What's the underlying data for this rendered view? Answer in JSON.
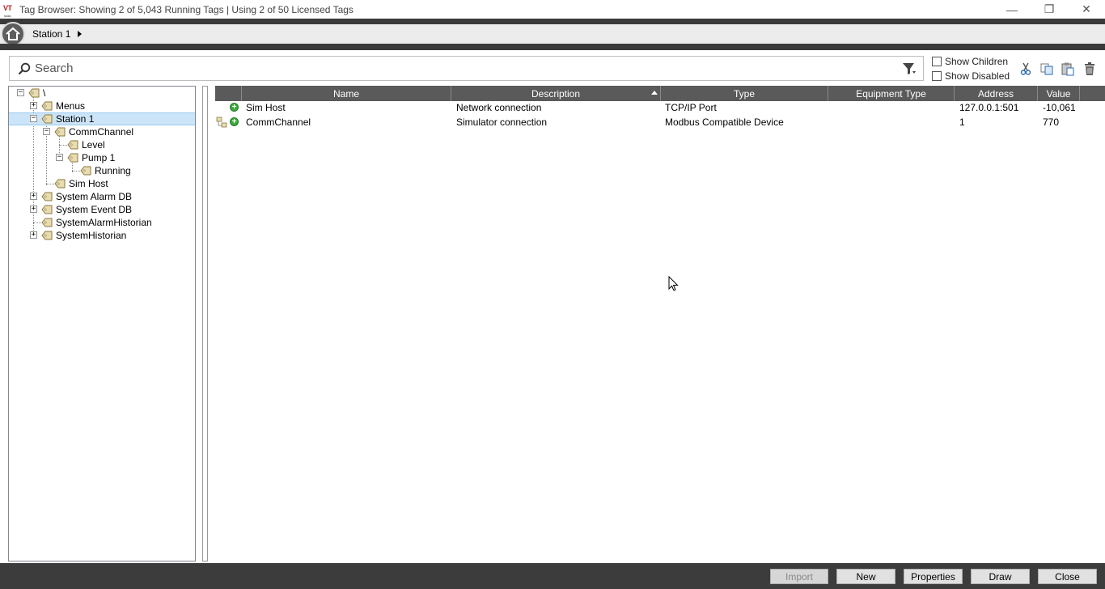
{
  "window": {
    "logo_text": "VT",
    "logo_sub": "SCADA",
    "title": "Tag Browser: Showing 2 of 5,043 Running Tags | Using 2 of 50 Licensed Tags",
    "minimize": "—",
    "restore": "❐",
    "close": "✕"
  },
  "breadcrumb": {
    "current": "Station 1"
  },
  "search": {
    "placeholder": "Search",
    "value": ""
  },
  "options": {
    "show_children": "Show Children",
    "show_disabled": "Show Disabled"
  },
  "tree": {
    "items": [
      {
        "label": "\\",
        "level": 0,
        "expander": "−"
      },
      {
        "label": "Menus",
        "level": 1,
        "expander": "+"
      },
      {
        "label": "Station 1",
        "level": 1,
        "expander": "−",
        "selected": true
      },
      {
        "label": "CommChannel",
        "level": 2,
        "expander": "−"
      },
      {
        "label": "Level",
        "level": 3,
        "expander": ""
      },
      {
        "label": "Pump 1",
        "level": 3,
        "expander": "−"
      },
      {
        "label": "Running",
        "level": 4,
        "expander": ""
      },
      {
        "label": "Sim Host",
        "level": 2,
        "expander": ""
      },
      {
        "label": "System Alarm DB",
        "level": 1,
        "expander": "+"
      },
      {
        "label": "System Event DB",
        "level": 1,
        "expander": "+"
      },
      {
        "label": "SystemAlarmHistorian",
        "level": 1,
        "expander": ""
      },
      {
        "label": "SystemHistorian",
        "level": 1,
        "expander": "+"
      }
    ]
  },
  "grid": {
    "columns": [
      "",
      "Name",
      "Description",
      "Type",
      "Equipment Type",
      "Address",
      "Value"
    ],
    "sort_column": "Description",
    "rows": [
      {
        "name": "Sim Host",
        "description": "Network connection",
        "type": "TCP/IP Port",
        "equipment_type": "",
        "address": "127.0.0.1:501",
        "value": "-10,061",
        "has_children": false
      },
      {
        "name": "CommChannel",
        "description": "Simulator connection",
        "type": "Modbus Compatible Device",
        "equipment_type": "",
        "address": "1",
        "value": "770",
        "has_children": true
      }
    ]
  },
  "buttons": {
    "import": "Import",
    "new": "New",
    "properties": "Properties",
    "draw": "Draw",
    "close": "Close"
  },
  "colors": {
    "dark_band": "#3a3a3a",
    "header_bg": "#5a5a5a",
    "selection": "#cce4f7",
    "tag_icon": "#e8dcb0",
    "add_green": "#3caa3c"
  },
  "icons": {
    "home": "home-icon",
    "search": "search-icon",
    "filter": "filter-icon",
    "cut": "cut-icon",
    "copy": "copy-icon",
    "paste": "paste-icon",
    "delete": "trash-icon",
    "tag": "tag-icon"
  }
}
